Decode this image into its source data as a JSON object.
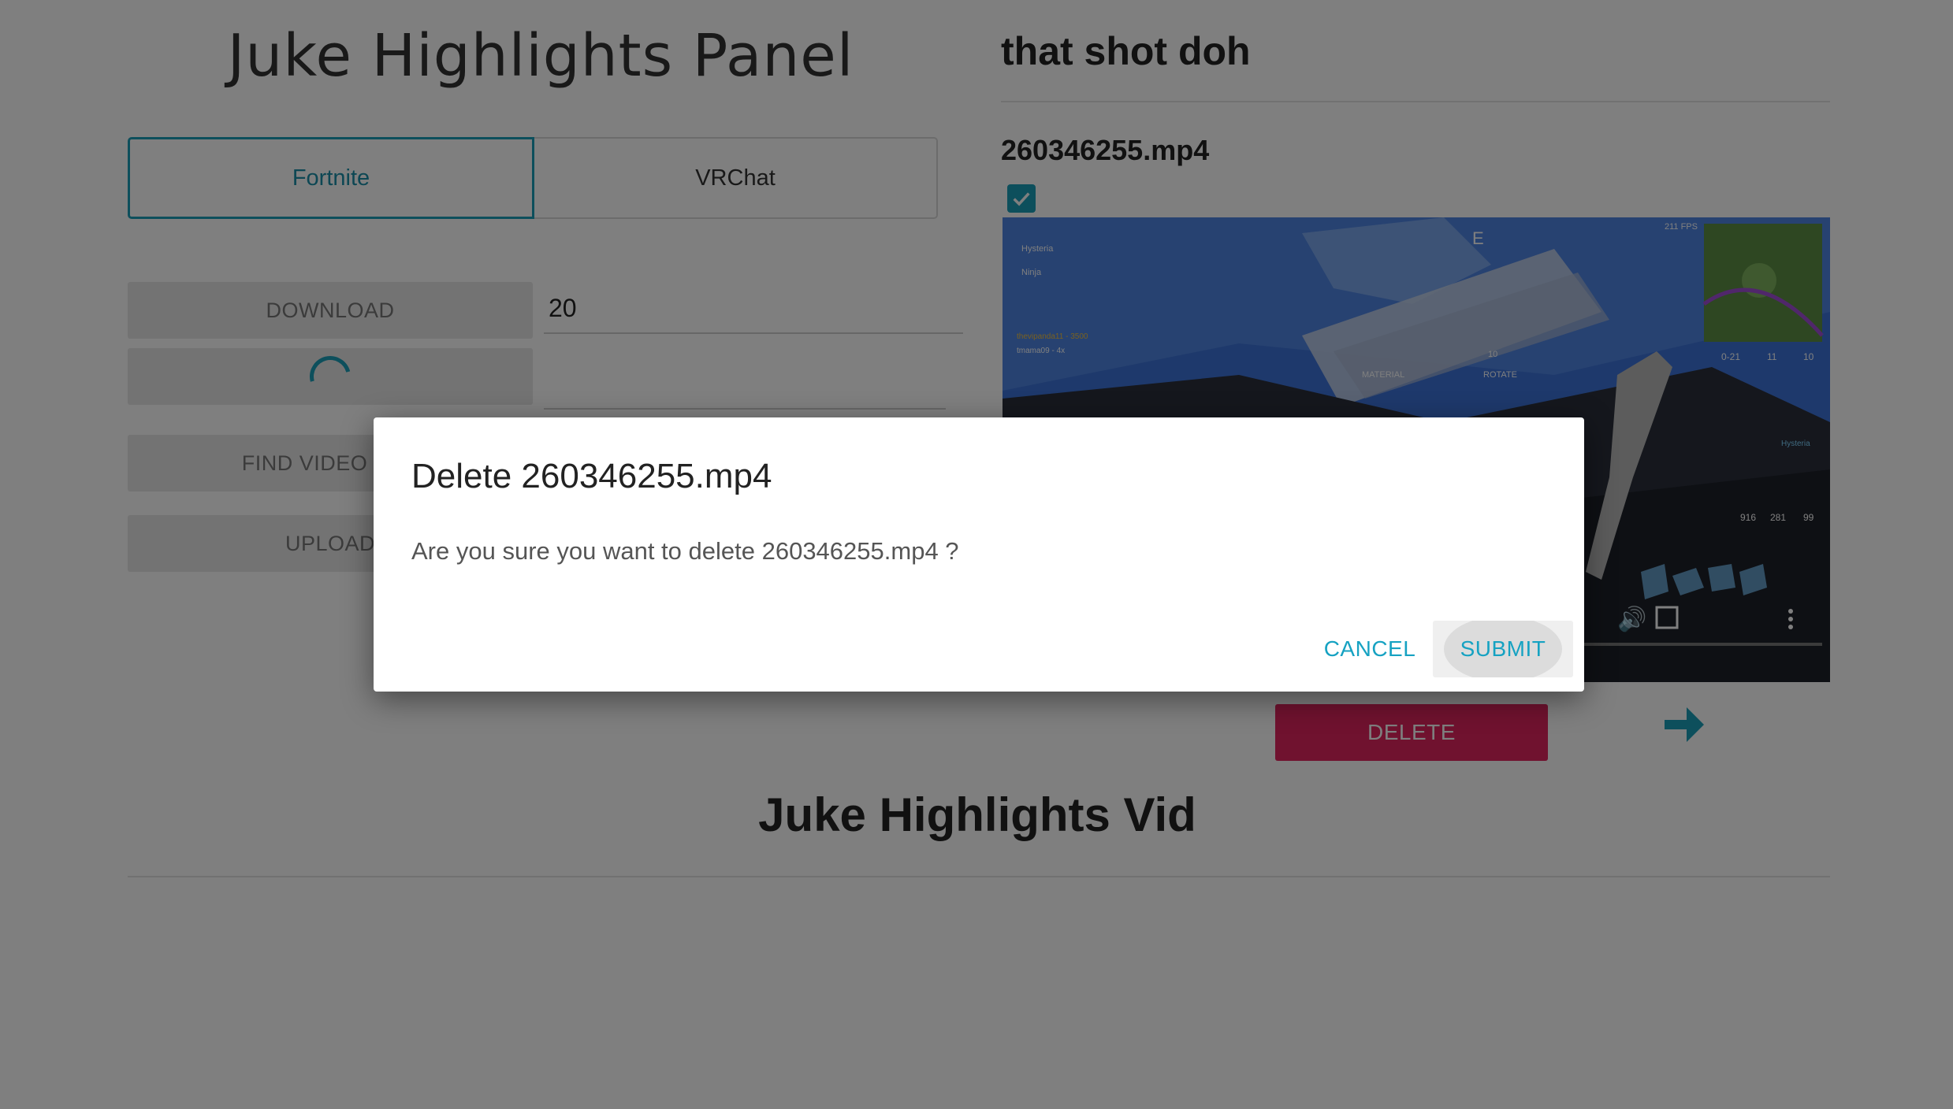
{
  "panel": {
    "title": "Juke Highlights Panel",
    "tabs": [
      {
        "label": "Fortnite",
        "active": true
      },
      {
        "label": "VRChat",
        "active": false
      }
    ],
    "download_label": "DOWNLOAD",
    "count_value": "20",
    "find_label": "FIND VIDEO DUF",
    "upload_label": "UPLOAD"
  },
  "clip": {
    "title": "that shot doh",
    "file_name": "260346255.mp4",
    "selected": true,
    "delete_label": "DELETE"
  },
  "video_hud": {
    "fps": "211 FPS",
    "compass": "E",
    "players": [
      "Hysteria",
      "Ninja"
    ],
    "feed": [
      "thevipanda11 - 3500",
      "tmama09 - 4x"
    ],
    "material_label": "MATERIAL",
    "rotate_label": "ROTATE",
    "rotate_count": "10",
    "stats": [
      "0-21",
      "11",
      "10"
    ],
    "resources": [
      "916",
      "281",
      "99"
    ],
    "tag": "Hysteria"
  },
  "footer": {
    "title": "Juke Highlights Vid"
  },
  "dialog": {
    "title": "Delete 260346255.mp4",
    "message": "Are you sure you want to delete 260346255.mp4 ?",
    "cancel_label": "CANCEL",
    "submit_label": "SUBMIT"
  },
  "colors": {
    "accent": "#1a9fb8",
    "delete": "#e0245e",
    "overlay": "rgba(0,0,0,0.5)"
  }
}
